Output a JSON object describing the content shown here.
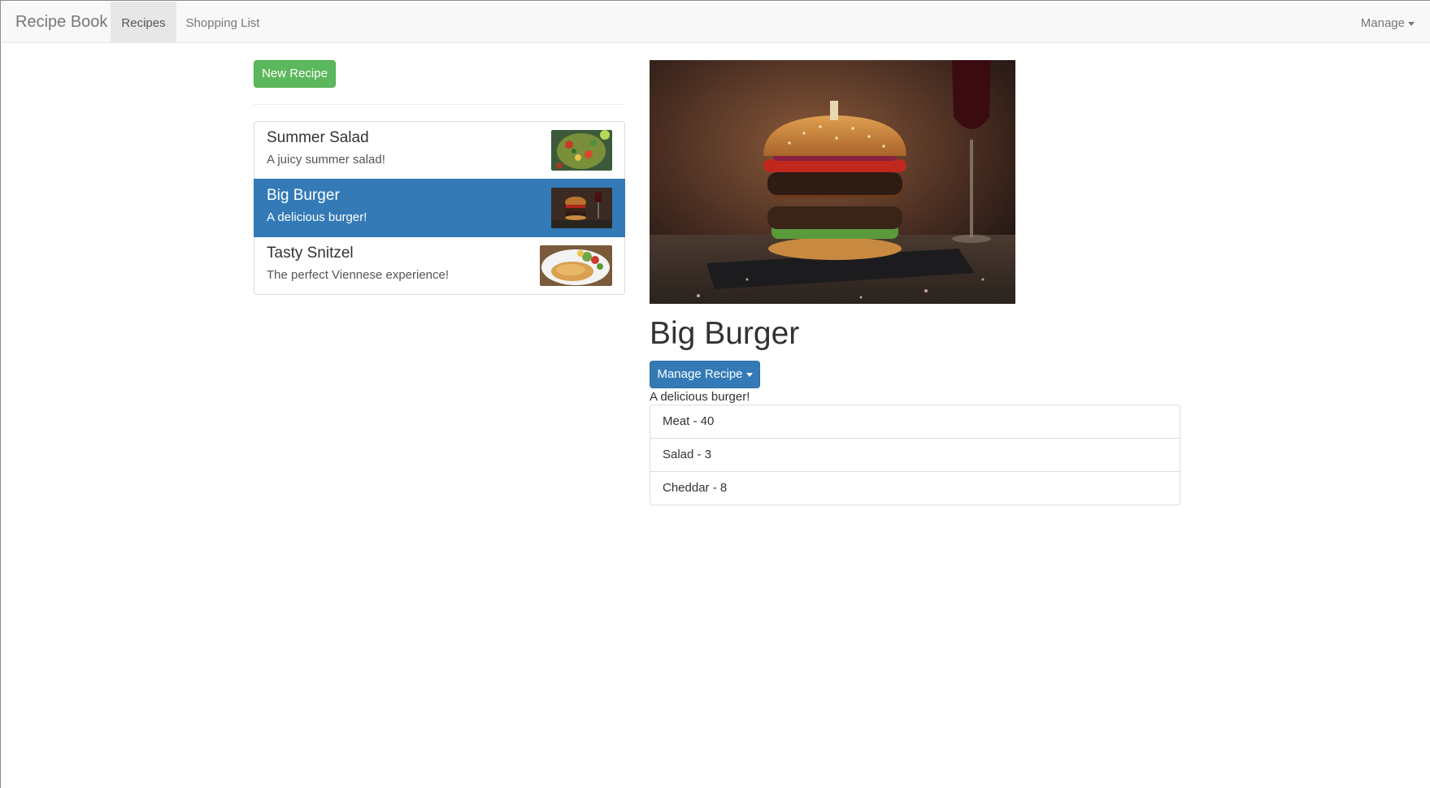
{
  "navbar": {
    "brand": "Recipe Book",
    "tabs": [
      {
        "label": "Recipes",
        "active": true
      },
      {
        "label": "Shopping List",
        "active": false
      }
    ],
    "manage_label": "Manage"
  },
  "recipes_panel": {
    "new_recipe_label": "New Recipe",
    "items": [
      {
        "name": "Summer Salad",
        "description": "A juicy summer salad!",
        "image": "salad-photo",
        "active": false
      },
      {
        "name": "Big Burger",
        "description": "A delicious burger!",
        "image": "burger-photo",
        "active": true
      },
      {
        "name": "Tasty Snitzel",
        "description": "The perfect Viennese experience!",
        "image": "schnitzel-photo",
        "active": false
      }
    ]
  },
  "detail": {
    "image": "burger-photo",
    "title": "Big Burger",
    "manage_recipe_label": "Manage Recipe",
    "description": "A delicious burger!",
    "ingredients": [
      "Meat - 40",
      "Salad - 3",
      "Cheddar - 8"
    ]
  },
  "colors": {
    "success": "#5cb85c",
    "primary": "#337ab7",
    "navbar_bg": "#f8f8f8",
    "active_tab_bg": "#e7e7e7"
  }
}
